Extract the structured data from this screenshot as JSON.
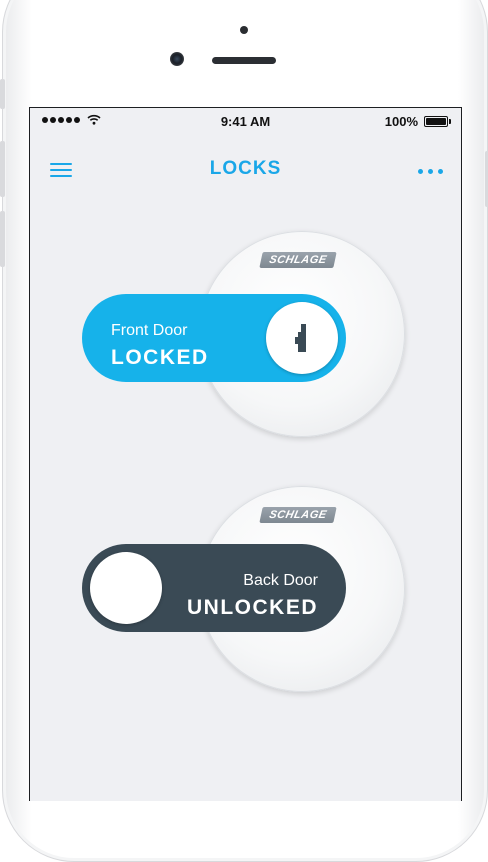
{
  "status_bar": {
    "time": "9:41 AM",
    "battery": "100%"
  },
  "navbar": {
    "title": "LOCKS"
  },
  "locks": [
    {
      "brand": "SCHLAGE",
      "name": "Front Door",
      "state": "LOCKED",
      "color": "#16b2ea"
    },
    {
      "brand": "SCHLAGE",
      "name": "Back Door",
      "state": "UNLOCKED",
      "color": "#3a4a55"
    }
  ],
  "icons": {
    "menu": "hamburger-menu-icon",
    "more": "more-dots-icon",
    "keyhole": "keyhole-icon"
  },
  "accent": "#1aa7e8"
}
